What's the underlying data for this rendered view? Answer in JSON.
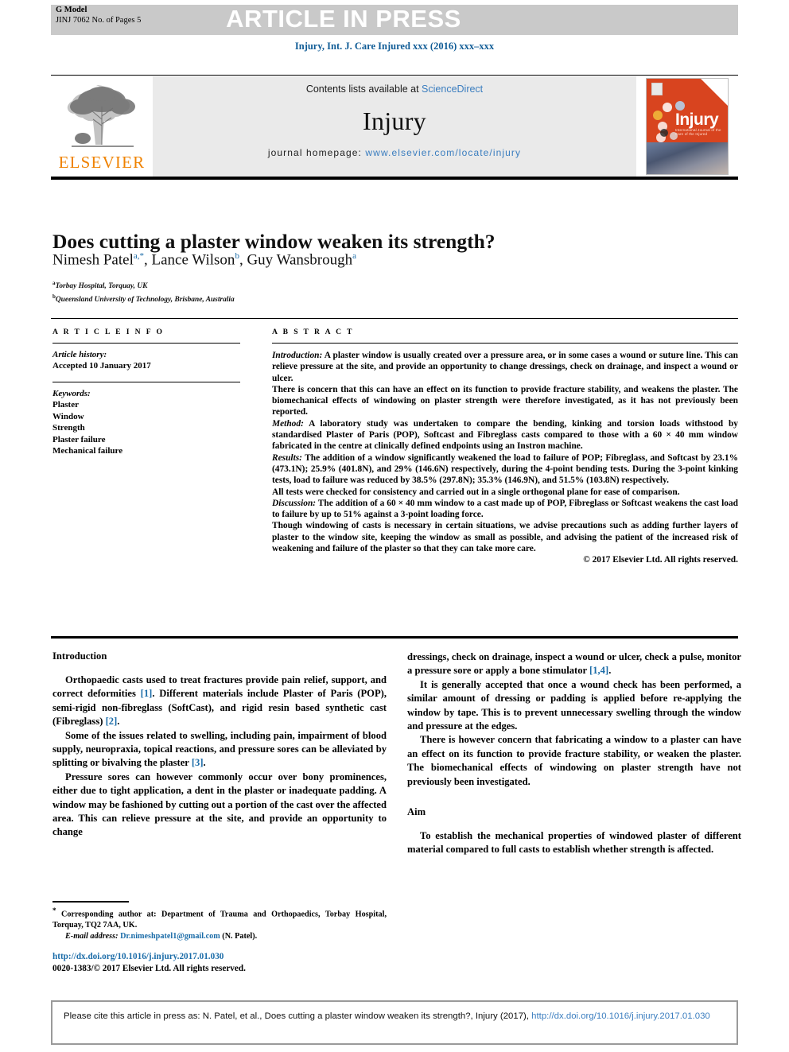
{
  "banner": {
    "g_model": "G Model",
    "id_line": "JINJ 7062 No. of Pages 5",
    "article_in_press": "ARTICLE IN PRESS"
  },
  "journal_ref": "Injury, Int. J. Care Injured xxx (2016) xxx–xxx",
  "masthead": {
    "contents_prefix": "Contents lists available at ",
    "sciencedirect": "ScienceDirect",
    "journal_name": "Injury",
    "homepage_label": "journal homepage:",
    "homepage_url": "www.elsevier.com/locate/injury",
    "elsevier_wordmark": "ELSEVIER",
    "cover_title": "Injury",
    "cover_subtitle": "International Journal of the Care of the Injured"
  },
  "article": {
    "title": "Does cutting a plaster window weaken its strength?",
    "authors_html": "Nimesh Patel<sup>a,*</sup>, Lance Wilson<sup>b</sup>, Guy Wansbrough<sup>a</sup>",
    "affiliations": [
      {
        "marker": "a",
        "text": "Torbay Hospital, Torquay, UK"
      },
      {
        "marker": "b",
        "text": "Queensland University of Technology, Brisbane, Australia"
      }
    ]
  },
  "info": {
    "heading": "A R T I C L E   I N F O",
    "history_label": "Article history:",
    "history_value": "Accepted 10 January 2017",
    "keywords_label": "Keywords:",
    "keywords": [
      "Plaster",
      "Window",
      "Strength",
      "Plaster failure",
      "Mechanical failure"
    ]
  },
  "abstract": {
    "heading": "A B S T R A C T",
    "paragraphs": [
      {
        "label": "Introduction:",
        "text": " A plaster window is usually created over a pressure area, or in some cases a wound or suture line. This can relieve pressure at the site, and provide an opportunity to change dressings, check on drainage, and inspect a wound or ulcer."
      },
      {
        "label": "",
        "text": "There is concern that this can have an effect on its function to provide fracture stability, and weakens the plaster. The biomechanical effects of windowing on plaster strength were therefore investigated, as it has not previously been reported."
      },
      {
        "label": "Method:",
        "text": " A laboratory study was undertaken to compare the bending, kinking and torsion loads withstood by standardised Plaster of Paris (POP), Softcast and Fibreglass casts compared to those with a 60 × 40 mm window fabricated in the centre at clinically defined endpoints using an Instron machine."
      },
      {
        "label": "Results:",
        "text": " The addition of a window significantly weakened the load to failure of POP; Fibreglass, and Softcast by 23.1% (473.1N); 25.9% (401.8N), and 29% (146.6N) respectively, during the 4-point bending tests. During the 3-point kinking tests, load to failure was reduced by 38.5% (297.8N); 35.3% (146.9N), and 51.5% (103.8N) respectively."
      },
      {
        "label": "",
        "text": "All tests were checked for consistency and carried out in a single orthogonal plane for ease of comparison."
      },
      {
        "label": "Discussion:",
        "text": " The addition of a 60 × 40 mm window to a cast made up of POP, Fibreglass or Softcast weakens the cast load to failure by up to 51% against a 3-point loading force."
      },
      {
        "label": "",
        "text": "Though windowing of casts is necessary in certain situations, we advise precautions such as adding further layers of plaster to the window site, keeping the window as small as possible, and advising the patient of the increased risk of weakening and failure of the plaster so that they can take more care."
      }
    ],
    "copyright": "© 2017 Elsevier Ltd. All rights reserved."
  },
  "body": {
    "left": {
      "heading": "Introduction",
      "paragraphs": [
        "Orthopaedic casts used to treat fractures provide pain relief, support, and correct deformities [1]. Different materials include Plaster of Paris (POP), semi-rigid non-fibreglass (SoftCast), and rigid resin based synthetic cast (Fibreglass) [2].",
        "Some of the issues related to swelling, including pain, impairment of blood supply, neuropraxia, topical reactions, and pressure sores can be alleviated by splitting or bivalving the plaster [3].",
        "Pressure sores can however commonly occur over bony prominences, either due to tight application, a dent in the plaster or inadequate padding. A window may be fashioned by cutting out a portion of the cast over the affected area. This can relieve pressure at the site, and provide an opportunity to change"
      ]
    },
    "right": {
      "paragraphs": [
        "dressings, check on drainage, inspect a wound or ulcer, check a pulse, monitor a pressure sore or apply a bone stimulator [1,4].",
        "It is generally accepted that once a wound check has been performed, a similar amount of dressing or padding is applied before re-applying the window by tape. This is to prevent unnecessary swelling through the window and pressure at the edges.",
        "There is however concern that fabricating a window to a plaster can have an effect on its function to provide fracture stability, or weaken the plaster. The biomechanical effects of windowing on plaster strength have not previously been investigated."
      ],
      "aim_heading": "Aim",
      "aim_paragraph": "To establish the mechanical properties of windowed plaster of different material compared to full casts to establish whether strength is affected."
    }
  },
  "footnote": {
    "corresponding": "Corresponding author at: Department of Trauma and Orthopaedics, Torbay Hospital, Torquay, TQ2 7AA, UK.",
    "email_label": "E-mail address:",
    "email": "Dr.nimeshpatel1@gmail.com",
    "email_suffix": " (N. Patel).",
    "doi_url": "http://dx.doi.org/10.1016/j.injury.2017.01.030",
    "issn_line": "0020-1383/© 2017 Elsevier Ltd. All rights reserved."
  },
  "citation_footer": {
    "prefix": "Please cite this article in press as: N. Patel, et al., Does cutting a plaster window weaken its strength?, Injury (2017), ",
    "link": "http://dx.doi.org/10.1016/j.injury.2017.01.030"
  },
  "colors": {
    "link_blue": "#1b6ca8",
    "sd_blue": "#3a7dbf",
    "elsevier_orange": "#ef8200",
    "banner_grey": "#c9c9c9",
    "masthead_grey": "#eaeaea",
    "cover_red": "#d8441f"
  }
}
